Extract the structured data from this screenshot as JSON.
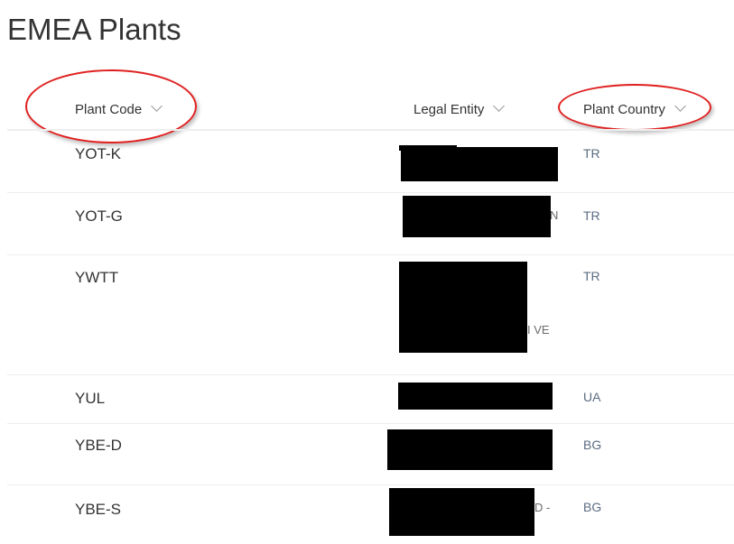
{
  "page": {
    "title": "EMEA Plants"
  },
  "columns": [
    {
      "label": "Plant Code"
    },
    {
      "label": "Legal Entity"
    },
    {
      "label": "Plant Country"
    }
  ],
  "rows": [
    {
      "plant_code": "YOT-K",
      "legal_entity_fragment": "",
      "country": "TR"
    },
    {
      "plant_code": "YOT-G",
      "legal_entity_fragment": "N",
      "country": "TR"
    },
    {
      "plant_code": "YWTT",
      "legal_entity_fragment": "I VE",
      "country": "TR"
    },
    {
      "plant_code": "YUL",
      "legal_entity_fragment": "",
      "country": "UA"
    },
    {
      "plant_code": "YBE-D",
      "legal_entity_fragment": "",
      "country": "BG"
    },
    {
      "plant_code": "YBE-S",
      "legal_entity_fragment": "D -",
      "country": "BG"
    }
  ],
  "annotation_color": "#e02020"
}
